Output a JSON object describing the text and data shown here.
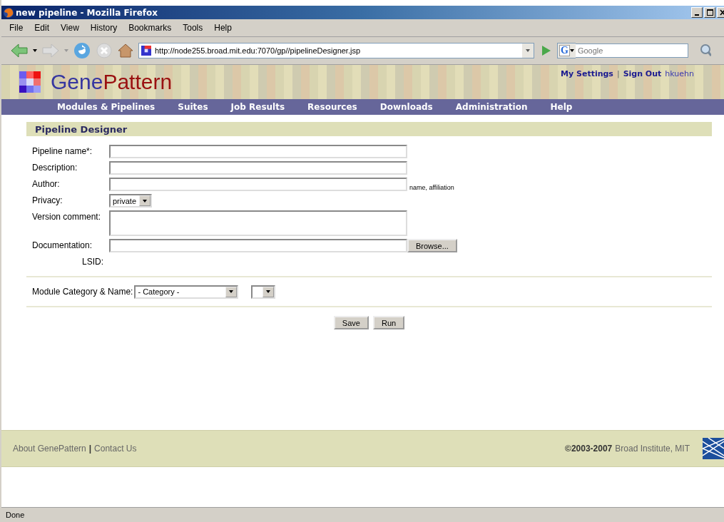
{
  "window": {
    "title": "new pipeline - Mozilla Firefox"
  },
  "menu": [
    "File",
    "Edit",
    "View",
    "History",
    "Bookmarks",
    "Tools",
    "Help"
  ],
  "toolbar": {
    "url": "http://node255.broad.mit.edu:7070/gp//pipelineDesigner.jsp",
    "search_placeholder": "Google",
    "engine": "G"
  },
  "header": {
    "logo_first": "Gene",
    "logo_second": "Pattern",
    "links": [
      "My Settings",
      "Sign Out"
    ],
    "separator": "|",
    "user": "hkuehn"
  },
  "nav": [
    "Modules & Pipelines",
    "Suites",
    "Job Results",
    "Resources",
    "Downloads",
    "Administration",
    "Help"
  ],
  "section_title": "Pipeline Designer",
  "form": [
    {
      "kind": "text",
      "label": "Pipeline name*:"
    },
    {
      "kind": "text",
      "label": "Description:"
    },
    {
      "kind": "text",
      "label": "Author:",
      "hint": "name, affiliation"
    },
    {
      "kind": "select",
      "label": "Privacy:",
      "value": "private"
    },
    {
      "kind": "textarea",
      "label": "Version comment:"
    },
    {
      "kind": "file",
      "label": "Documentation:",
      "button": "Browse..."
    },
    {
      "kind": "static",
      "label": "LSID:"
    }
  ],
  "module": {
    "label": "Module Category & Name:",
    "category": "- Category -"
  },
  "buttons": [
    "Save",
    "Run"
  ],
  "footer": {
    "links": [
      "About GenePattern",
      "Contact Us"
    ],
    "separator": "|",
    "copyright": "©2003-2007",
    "owner": "Broad Institute, MIT"
  },
  "status_bar": "Done"
}
